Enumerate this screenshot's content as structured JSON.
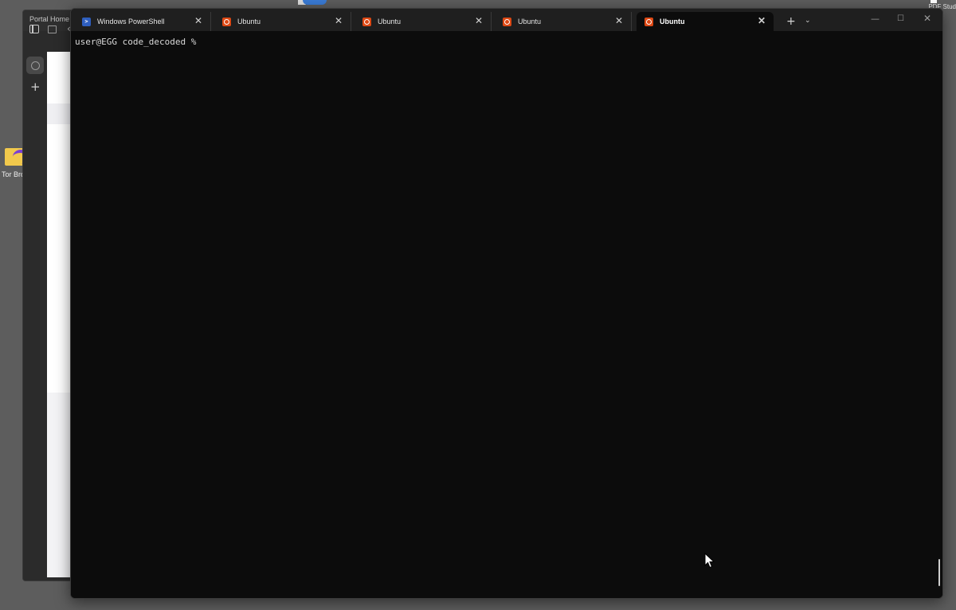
{
  "desktop": {
    "top_right_label": "PDF Stud",
    "icons": [
      {
        "label": "Tor Bro"
      }
    ]
  },
  "browser": {
    "tab_title": "Portal Home"
  },
  "terminal": {
    "tabs": [
      {
        "label": "Windows PowerShell",
        "icon": "powershell-icon",
        "active": false
      },
      {
        "label": "Ubuntu",
        "icon": "ubuntu-icon",
        "active": false
      },
      {
        "label": "Ubuntu",
        "icon": "ubuntu-icon",
        "active": false
      },
      {
        "label": "Ubuntu",
        "icon": "ubuntu-icon",
        "active": false
      },
      {
        "label": "Ubuntu",
        "icon": "ubuntu-icon",
        "active": true
      }
    ],
    "close_glyph": "✕",
    "new_tab_glyph": "+",
    "dropdown_glyph": "⌄",
    "window_controls": {
      "minimize": "—",
      "maximize": "☐",
      "close": "✕"
    },
    "prompt": "user@EGG code_decoded %",
    "colors": {
      "background": "#0c0c0c",
      "titlebar": "#1f1f1f",
      "ubuntu_accent": "#dd4814",
      "powershell_accent": "#2f5fbf"
    }
  }
}
